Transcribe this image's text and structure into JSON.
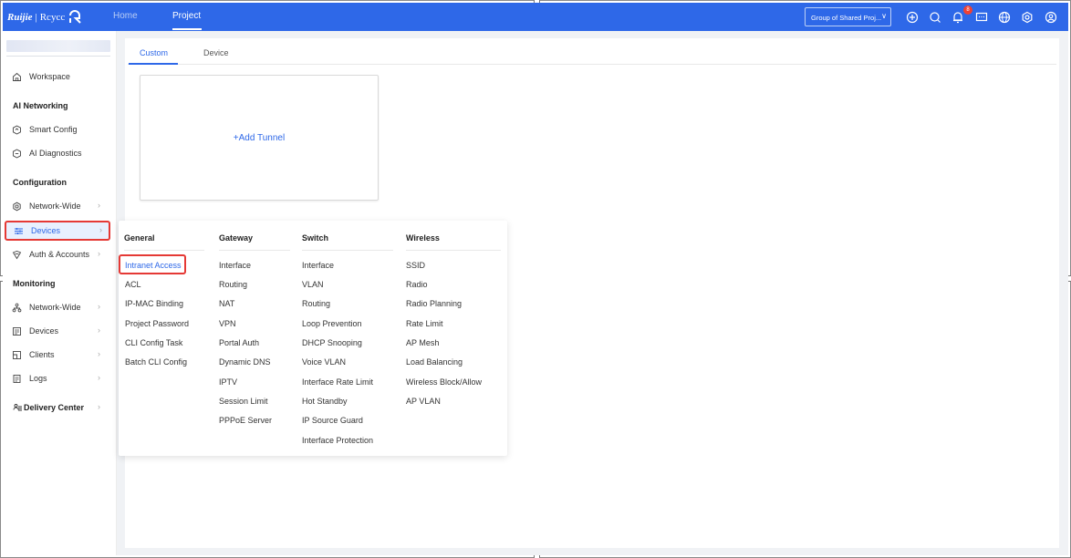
{
  "topbar": {
    "brand": "Ruijie",
    "separator": "|",
    "product": "Rcycc",
    "nav": {
      "home": "Home",
      "project": "Project"
    },
    "project_select": "Group of Shared Proj...",
    "notification_count": "8",
    "icons": [
      "plus-circle-icon",
      "search-icon",
      "bell-icon",
      "message-icon",
      "globe-icon",
      "gear-icon",
      "user-icon"
    ],
    "bg_color": "#2e68e8"
  },
  "sidebar": {
    "workspace": "Workspace",
    "sections": {
      "ai": "AI Networking",
      "configuration": "Configuration",
      "monitoring": "Monitoring"
    },
    "ai_items": [
      "Smart Config",
      "AI Diagnostics"
    ],
    "config_items": [
      "Network-Wide",
      "Devices",
      "Auth & Accounts"
    ],
    "monitor_items": [
      "Network-Wide",
      "Devices",
      "Clients",
      "Logs"
    ],
    "delivery": "Delivery Center",
    "active_item": "Devices"
  },
  "main": {
    "tabs": [
      "Custom",
      "Device"
    ],
    "active_tab": "Custom",
    "add_tunnel": "+Add Tunnel"
  },
  "menu": {
    "columns": [
      {
        "title": "General",
        "items": [
          "Intranet Access",
          "ACL",
          "IP-MAC Binding",
          "Project Password",
          "CLI Config Task",
          "Batch CLI Config"
        ]
      },
      {
        "title": "Gateway",
        "items": [
          "Interface",
          "Routing",
          "NAT",
          "VPN",
          "Portal Auth",
          "Dynamic DNS",
          "IPTV",
          "Session Limit",
          "PPPoE Server"
        ]
      },
      {
        "title": "Switch",
        "items": [
          "Interface",
          "VLAN",
          "Routing",
          "Loop Prevention",
          "DHCP Snooping",
          "Voice VLAN",
          "Interface Rate Limit",
          "Hot Standby",
          "IP Source Guard",
          "Interface Protection"
        ]
      },
      {
        "title": "Wireless",
        "items": [
          "SSID",
          "Radio",
          "Radio Planning",
          "Rate Limit",
          "AP Mesh",
          "Load Balancing",
          "Wireless Block/Allow",
          "AP VLAN"
        ]
      }
    ],
    "highlighted_item": "Intranet Access",
    "accent_color": "#2e68e8",
    "highlight_color": "#e53935"
  }
}
